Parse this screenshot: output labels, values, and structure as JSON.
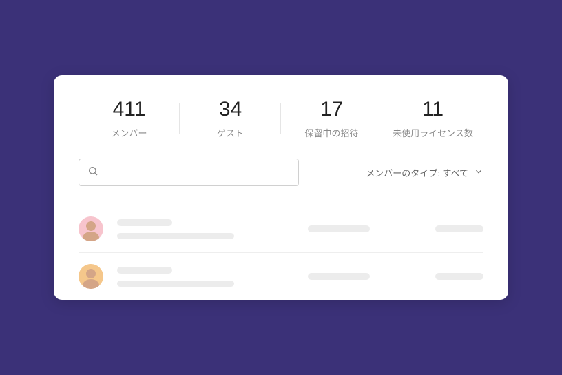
{
  "stats": [
    {
      "value": "411",
      "label": "メンバー"
    },
    {
      "value": "34",
      "label": "ゲスト"
    },
    {
      "value": "17",
      "label": "保留中の招待"
    },
    {
      "value": "11",
      "label": "未使用ライセンス数"
    }
  ],
  "search": {
    "placeholder": ""
  },
  "filter": {
    "label": "メンバーのタイプ: すべて"
  },
  "rows": [
    {
      "avatar_color": "pink"
    },
    {
      "avatar_color": "orange"
    }
  ]
}
